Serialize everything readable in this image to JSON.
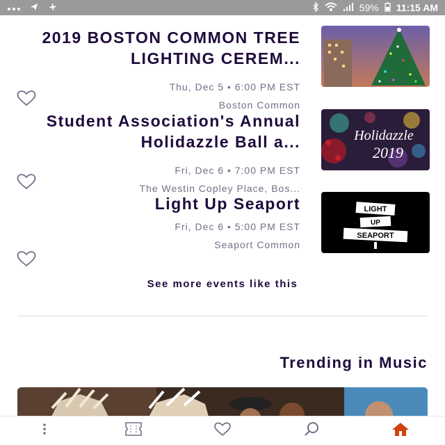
{
  "status_bar": {
    "time": "11:15 AM",
    "battery": "59%",
    "icons": [
      "alarm-icon",
      "bluetooth-icon",
      "wifi-icon",
      "signal-icon",
      "battery-icon",
      "more-dots-icon",
      "location-icon",
      "fan-icon"
    ]
  },
  "events": [
    {
      "title": "2019 BOSTON COMMON TREE LIGHTING CEREM...",
      "date": "Thu, Dec 5 • 6:00 PM EST",
      "venue": "Boston Common",
      "image": "christmas-tree-image"
    },
    {
      "title": "Student Association's Annual Holidazzle Ball a...",
      "date": "Fri, Dec 6 • 7:00 PM EST",
      "venue": "The Westin Copley Place, Bos...",
      "image": "holidazzle-2019-image",
      "image_text_line1": "Holidazzle",
      "image_text_line2": "2019"
    },
    {
      "title": "Light Up Seaport",
      "date": "Fri, Dec 6 • 5:00 PM EST",
      "venue": "Seaport Common",
      "image": "light-up-seaport-image",
      "image_text_line1": "LIGHT",
      "image_text_line2": "UP",
      "image_text_line3": "SEAPORT"
    }
  ],
  "see_more_label": "See more events like this",
  "section_title": "Trending in Music",
  "tab_bar": {
    "tabs": [
      "home-icon",
      "search-icon",
      "heart-icon",
      "tickets-icon",
      "more-icon"
    ],
    "active": "home-icon",
    "accent": "#d1410c"
  }
}
